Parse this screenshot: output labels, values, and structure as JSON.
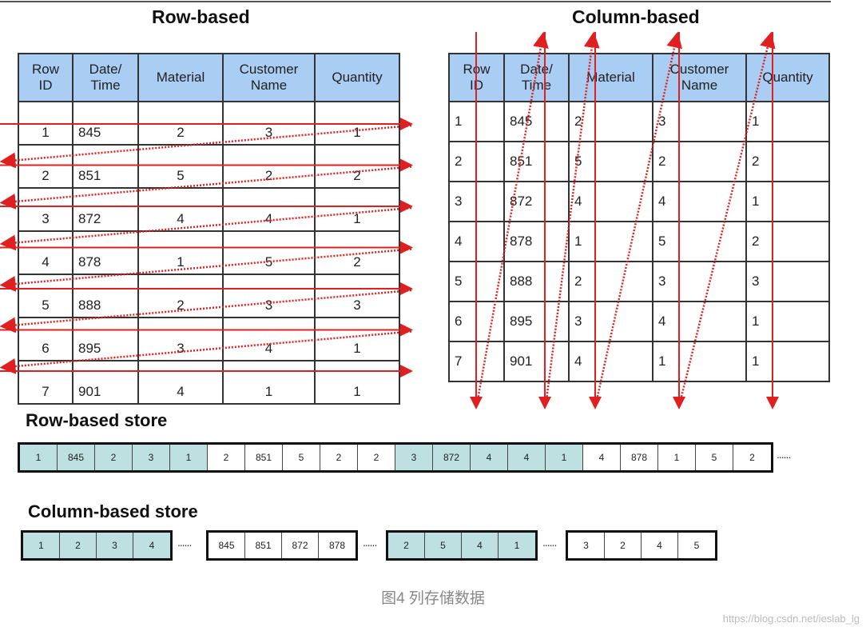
{
  "titles": {
    "row_based": "Row-based",
    "column_based": "Column-based",
    "row_store": "Row-based store",
    "column_store": "Column-based store"
  },
  "columns": [
    "Row\nID",
    "Date/\nTime",
    "Material",
    "Customer\nName",
    "Quantity"
  ],
  "rows": [
    [
      "1",
      "845",
      "2",
      "3",
      "1"
    ],
    [
      "2",
      "851",
      "5",
      "2",
      "2"
    ],
    [
      "3",
      "872",
      "4",
      "4",
      "1"
    ],
    [
      "4",
      "878",
      "1",
      "5",
      "2"
    ],
    [
      "5",
      "888",
      "2",
      "3",
      "3"
    ],
    [
      "6",
      "895",
      "3",
      "4",
      "1"
    ],
    [
      "7",
      "901",
      "4",
      "1",
      "1"
    ]
  ],
  "row_store": {
    "values": [
      "1",
      "845",
      "2",
      "3",
      "1",
      "2",
      "851",
      "5",
      "2",
      "2",
      "3",
      "872",
      "4",
      "4",
      "1",
      "4",
      "878",
      "1",
      "5",
      "2"
    ],
    "highlighted_rows": [
      1,
      3
    ],
    "ellipsis": "......"
  },
  "column_store": {
    "groups": [
      {
        "values": [
          "1",
          "2",
          "3",
          "4"
        ],
        "highlighted": true
      },
      {
        "values": [
          "845",
          "851",
          "872",
          "878"
        ],
        "highlighted": false
      },
      {
        "values": [
          "2",
          "5",
          "4",
          "1"
        ],
        "highlighted": true
      },
      {
        "values": [
          "3",
          "2",
          "4",
          "5"
        ],
        "highlighted": false
      }
    ],
    "ellipsis": "......"
  },
  "caption": "图4 列存储数据",
  "watermark": "https://blog.csdn.net/ieslab_lg",
  "colors": {
    "header": "#a9cdf3",
    "highlight": "#bfe0e0",
    "arrow": "#e02020"
  }
}
